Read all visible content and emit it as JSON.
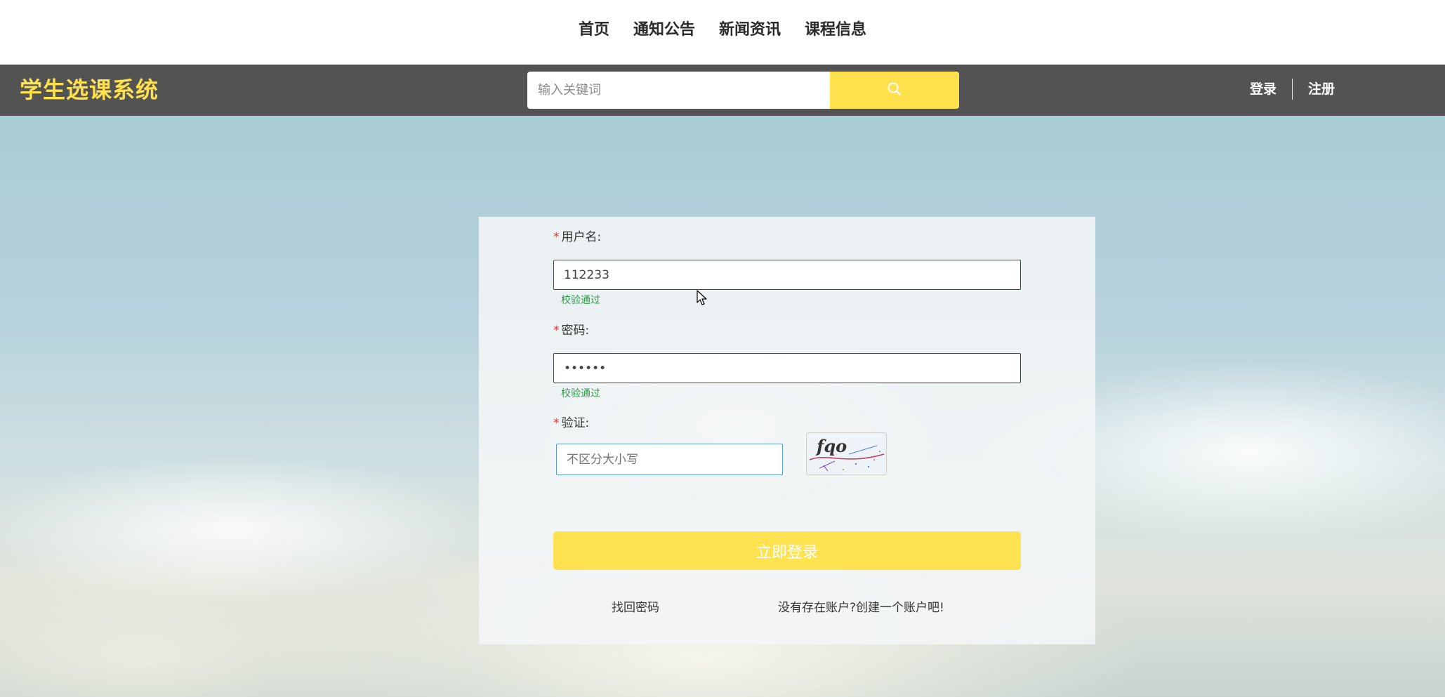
{
  "top_nav": {
    "links": [
      "首页",
      "通知公告",
      "新闻资讯",
      "课程信息"
    ]
  },
  "header": {
    "site_title": "学生选课系统",
    "search_placeholder": "输入关键词",
    "search_icon": "search-icon",
    "login_label": "登录",
    "register_label": "注册"
  },
  "login_form": {
    "username": {
      "label": "用户名:",
      "value": "112233",
      "status": "校验通过"
    },
    "password": {
      "label": "密码:",
      "value": "••••••",
      "status": "校验通过"
    },
    "captcha": {
      "label": "验证:",
      "placeholder": "不区分大小写",
      "image_text": "fqo"
    },
    "submit_label": "立即登录",
    "forgot_password_label": "找回密码",
    "register_prompt_label": "没有存在账户?创建一个账户吧!"
  },
  "colors": {
    "accent_yellow": "#ffe24f",
    "header_bg": "#535353",
    "valid_green": "#2e9b4b",
    "required_red": "#e23b3b"
  }
}
